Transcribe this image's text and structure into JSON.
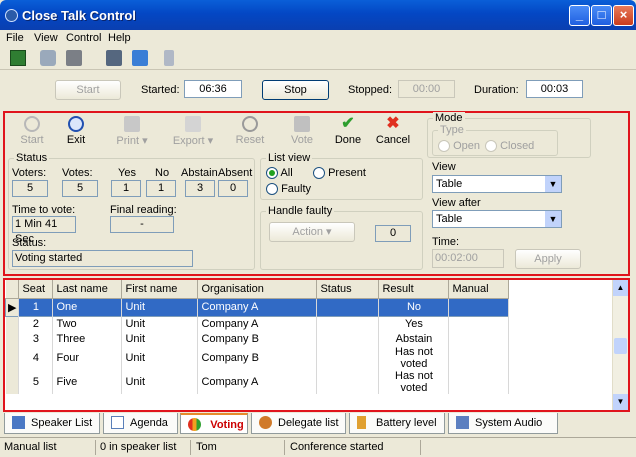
{
  "window": {
    "title": "Close Talk Control"
  },
  "menu": [
    "File",
    "View",
    "Control",
    "Help"
  ],
  "session": {
    "start_label": "Start",
    "started_label": "Started:",
    "started_value": "06:36",
    "stop_label": "Stop",
    "stopped_label": "Stopped:",
    "stopped_value": "00:00",
    "duration_label": "Duration:",
    "duration_value": "00:03"
  },
  "actions": {
    "start": "Start",
    "exit": "Exit",
    "print": "Print",
    "export": "Export",
    "reset": "Reset",
    "vote": "Vote",
    "done": "Done",
    "cancel": "Cancel"
  },
  "status": {
    "group": "Status",
    "voters_label": "Voters:",
    "votes_label": "Votes:",
    "yes_label": "Yes",
    "no_label": "No",
    "abstain_label": "Abstain",
    "absent_label": "Absent",
    "voters": "5",
    "votes": "5",
    "yes": "1",
    "no": "1",
    "abstain": "3",
    "absent": "0",
    "time_label": "Time to vote:",
    "time_value": "1 Min 41 Sec",
    "final_label": "Final reading:",
    "final_value": "-",
    "status_label": "Status:",
    "status_value": "Voting started"
  },
  "listview": {
    "group": "List view",
    "all": "All",
    "present": "Present",
    "faulty": "Faulty"
  },
  "faulty": {
    "group": "Handle faulty",
    "action": "Action",
    "count": "0"
  },
  "mode": {
    "group": "Mode",
    "type_label": "Type",
    "open": "Open",
    "closed": "Closed",
    "view_label": "View",
    "view_value": "Table",
    "view_after_label": "View after",
    "view_after_value": "Table",
    "time_label": "Time:",
    "time_value": "00:02:00",
    "apply": "Apply"
  },
  "table": {
    "headers": [
      "Seat",
      "Last name",
      "First name",
      "Organisation",
      "Status",
      "Result",
      "Manual"
    ],
    "rows": [
      [
        "1",
        "One",
        "Unit",
        "Company A",
        "",
        "No",
        ""
      ],
      [
        "2",
        "Two",
        "Unit",
        "Company A",
        "",
        "Yes",
        ""
      ],
      [
        "3",
        "Three",
        "Unit",
        "Company B",
        "",
        "Abstain",
        ""
      ],
      [
        "4",
        "Four",
        "Unit",
        "Company B",
        "",
        "Has not voted",
        ""
      ],
      [
        "5",
        "Five",
        "Unit",
        "Company A",
        "",
        "Has not voted",
        ""
      ]
    ]
  },
  "tabs": [
    "Speaker List",
    "Agenda",
    "Voting",
    "Delegate list",
    "Battery level",
    "System Audio"
  ],
  "statusbar": [
    "Manual list",
    "0 in speaker list",
    "Tom",
    "Conference started"
  ],
  "colors": {
    "accent_border": "#e0141c",
    "selection": "#316ac5"
  }
}
